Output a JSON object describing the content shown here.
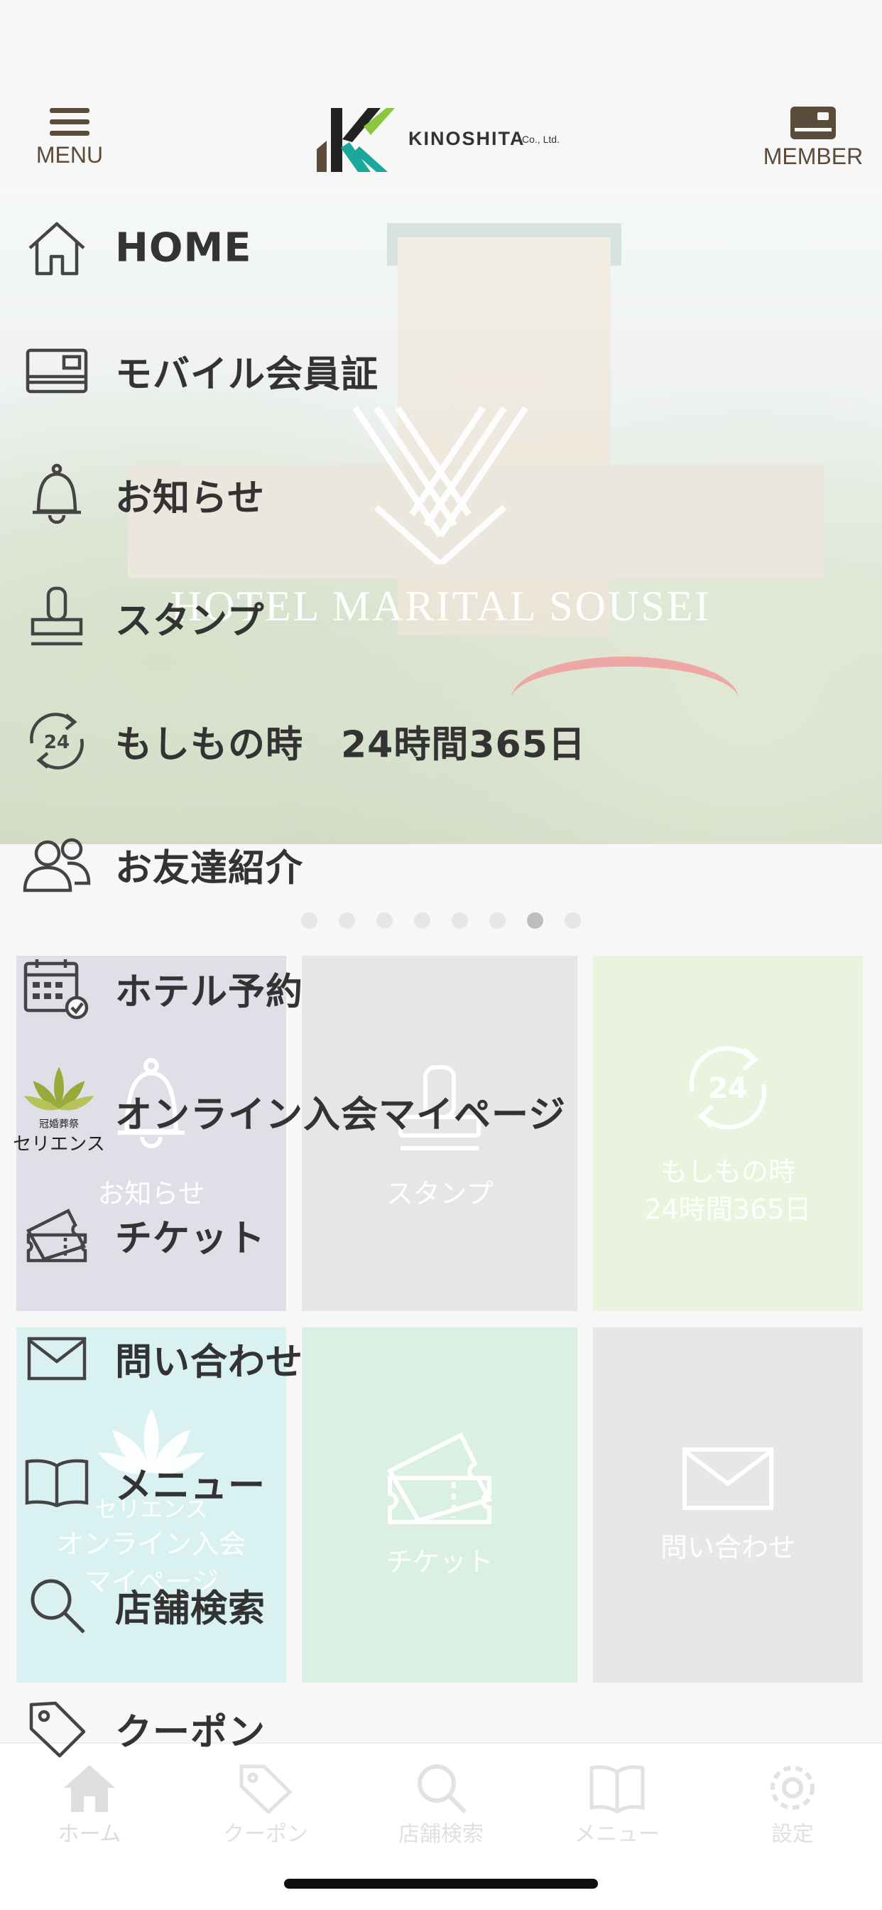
{
  "header": {
    "menu_label": "MENU",
    "member_label": "MEMBER",
    "logo_text": "KINOSHITA",
    "logo_suffix": "Co., Ltd."
  },
  "hero": {
    "hotel_name": "HOTEL MARITAL SOUSEI",
    "slide_count": 8,
    "active_slide": 7
  },
  "tiles": [
    {
      "label": "お知らせ",
      "icon": "bell-icon"
    },
    {
      "label": "スタンプ",
      "icon": "stamp-icon"
    },
    {
      "label_line1": "もしもの時",
      "label_line2": "24時間365日",
      "icon": "refresh-24-icon"
    },
    {
      "label_line1": "オンライン入会",
      "label_line2": "マイページ",
      "icon": "selience-logo",
      "brand": "セリエンス"
    },
    {
      "label": "チケット",
      "icon": "ticket-icon"
    },
    {
      "label": "問い合わせ",
      "icon": "mail-icon"
    }
  ],
  "menu": {
    "items": [
      {
        "label": "HOME",
        "icon": "home-icon"
      },
      {
        "label": "モバイル会員証",
        "icon": "card-icon"
      },
      {
        "label": "お知らせ",
        "icon": "bell-icon"
      },
      {
        "label": "スタンプ",
        "icon": "stamp-icon"
      },
      {
        "label": "もしもの時　24時間365日",
        "icon": "refresh-24-icon"
      },
      {
        "label": "お友達紹介",
        "icon": "users-icon"
      },
      {
        "label": "ホテル予約",
        "icon": "calendar-check-icon"
      },
      {
        "label": "オンライン入会マイページ",
        "icon": "selience-logo",
        "brand_small": "冠婚葬祭",
        "brand": "セリエンス"
      },
      {
        "label": "チケット",
        "icon": "ticket-icon"
      },
      {
        "label": "問い合わせ",
        "icon": "mail-icon"
      },
      {
        "label": "メニュー",
        "icon": "book-icon"
      },
      {
        "label": "店舗検索",
        "icon": "search-icon"
      },
      {
        "label": "クーポン",
        "icon": "tag-icon"
      }
    ]
  },
  "tabbar": {
    "tabs": [
      {
        "label": "ホーム",
        "icon": "home-icon"
      },
      {
        "label": "クーポン",
        "icon": "tag-icon"
      },
      {
        "label": "店舗検索",
        "icon": "search-icon"
      },
      {
        "label": "メニュー",
        "icon": "book-icon"
      },
      {
        "label": "設定",
        "icon": "gear-icon"
      }
    ]
  },
  "colors": {
    "brand_brown": "#5b4b3b",
    "logo_green": "#8cc63f",
    "logo_teal": "#1aa89a",
    "menu_text": "#333333"
  }
}
